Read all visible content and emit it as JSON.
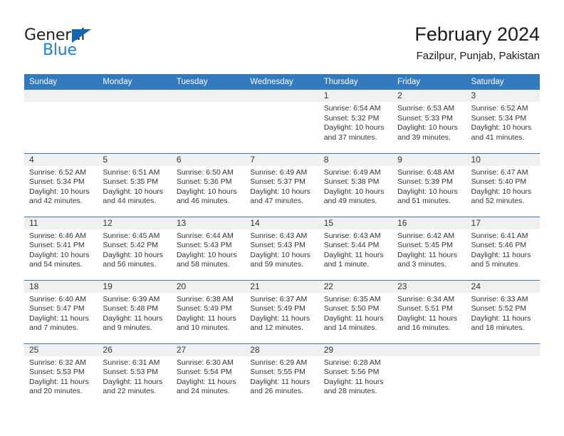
{
  "brand": {
    "logo_text_primary": "General",
    "logo_text_secondary": "Blue",
    "color_primary": "#231f20",
    "color_secondary": "#1b7fd4",
    "triangle_color": "#1565b0"
  },
  "header": {
    "title": "February 2024",
    "subtitle": "Fazilpur, Punjab, Pakistan"
  },
  "theme": {
    "header_row_bg": "#3379bd",
    "daynum_band_bg": "#f0f0f0",
    "row_divider": "#3379bd",
    "text": "#333333"
  },
  "weekdays": [
    "Sunday",
    "Monday",
    "Tuesday",
    "Wednesday",
    "Thursday",
    "Friday",
    "Saturday"
  ],
  "weeks": [
    [
      {
        "day": "",
        "sunrise": "",
        "sunset": "",
        "daylight": "",
        "daylight2": ""
      },
      {
        "day": "",
        "sunrise": "",
        "sunset": "",
        "daylight": "",
        "daylight2": ""
      },
      {
        "day": "",
        "sunrise": "",
        "sunset": "",
        "daylight": "",
        "daylight2": ""
      },
      {
        "day": "",
        "sunrise": "",
        "sunset": "",
        "daylight": "",
        "daylight2": ""
      },
      {
        "day": "1",
        "sunrise": "Sunrise: 6:54 AM",
        "sunset": "Sunset: 5:32 PM",
        "daylight": "Daylight: 10 hours",
        "daylight2": "and 37 minutes."
      },
      {
        "day": "2",
        "sunrise": "Sunrise: 6:53 AM",
        "sunset": "Sunset: 5:33 PM",
        "daylight": "Daylight: 10 hours",
        "daylight2": "and 39 minutes."
      },
      {
        "day": "3",
        "sunrise": "Sunrise: 6:52 AM",
        "sunset": "Sunset: 5:34 PM",
        "daylight": "Daylight: 10 hours",
        "daylight2": "and 41 minutes."
      }
    ],
    [
      {
        "day": "4",
        "sunrise": "Sunrise: 6:52 AM",
        "sunset": "Sunset: 5:34 PM",
        "daylight": "Daylight: 10 hours",
        "daylight2": "and 42 minutes."
      },
      {
        "day": "5",
        "sunrise": "Sunrise: 6:51 AM",
        "sunset": "Sunset: 5:35 PM",
        "daylight": "Daylight: 10 hours",
        "daylight2": "and 44 minutes."
      },
      {
        "day": "6",
        "sunrise": "Sunrise: 6:50 AM",
        "sunset": "Sunset: 5:36 PM",
        "daylight": "Daylight: 10 hours",
        "daylight2": "and 46 minutes."
      },
      {
        "day": "7",
        "sunrise": "Sunrise: 6:49 AM",
        "sunset": "Sunset: 5:37 PM",
        "daylight": "Daylight: 10 hours",
        "daylight2": "and 47 minutes."
      },
      {
        "day": "8",
        "sunrise": "Sunrise: 6:49 AM",
        "sunset": "Sunset: 5:38 PM",
        "daylight": "Daylight: 10 hours",
        "daylight2": "and 49 minutes."
      },
      {
        "day": "9",
        "sunrise": "Sunrise: 6:48 AM",
        "sunset": "Sunset: 5:39 PM",
        "daylight": "Daylight: 10 hours",
        "daylight2": "and 51 minutes."
      },
      {
        "day": "10",
        "sunrise": "Sunrise: 6:47 AM",
        "sunset": "Sunset: 5:40 PM",
        "daylight": "Daylight: 10 hours",
        "daylight2": "and 52 minutes."
      }
    ],
    [
      {
        "day": "11",
        "sunrise": "Sunrise: 6:46 AM",
        "sunset": "Sunset: 5:41 PM",
        "daylight": "Daylight: 10 hours",
        "daylight2": "and 54 minutes."
      },
      {
        "day": "12",
        "sunrise": "Sunrise: 6:45 AM",
        "sunset": "Sunset: 5:42 PM",
        "daylight": "Daylight: 10 hours",
        "daylight2": "and 56 minutes."
      },
      {
        "day": "13",
        "sunrise": "Sunrise: 6:44 AM",
        "sunset": "Sunset: 5:43 PM",
        "daylight": "Daylight: 10 hours",
        "daylight2": "and 58 minutes."
      },
      {
        "day": "14",
        "sunrise": "Sunrise: 6:43 AM",
        "sunset": "Sunset: 5:43 PM",
        "daylight": "Daylight: 10 hours",
        "daylight2": "and 59 minutes."
      },
      {
        "day": "15",
        "sunrise": "Sunrise: 6:43 AM",
        "sunset": "Sunset: 5:44 PM",
        "daylight": "Daylight: 11 hours",
        "daylight2": "and 1 minute."
      },
      {
        "day": "16",
        "sunrise": "Sunrise: 6:42 AM",
        "sunset": "Sunset: 5:45 PM",
        "daylight": "Daylight: 11 hours",
        "daylight2": "and 3 minutes."
      },
      {
        "day": "17",
        "sunrise": "Sunrise: 6:41 AM",
        "sunset": "Sunset: 5:46 PM",
        "daylight": "Daylight: 11 hours",
        "daylight2": "and 5 minutes."
      }
    ],
    [
      {
        "day": "18",
        "sunrise": "Sunrise: 6:40 AM",
        "sunset": "Sunset: 5:47 PM",
        "daylight": "Daylight: 11 hours",
        "daylight2": "and 7 minutes."
      },
      {
        "day": "19",
        "sunrise": "Sunrise: 6:39 AM",
        "sunset": "Sunset: 5:48 PM",
        "daylight": "Daylight: 11 hours",
        "daylight2": "and 9 minutes."
      },
      {
        "day": "20",
        "sunrise": "Sunrise: 6:38 AM",
        "sunset": "Sunset: 5:49 PM",
        "daylight": "Daylight: 11 hours",
        "daylight2": "and 10 minutes."
      },
      {
        "day": "21",
        "sunrise": "Sunrise: 6:37 AM",
        "sunset": "Sunset: 5:49 PM",
        "daylight": "Daylight: 11 hours",
        "daylight2": "and 12 minutes."
      },
      {
        "day": "22",
        "sunrise": "Sunrise: 6:35 AM",
        "sunset": "Sunset: 5:50 PM",
        "daylight": "Daylight: 11 hours",
        "daylight2": "and 14 minutes."
      },
      {
        "day": "23",
        "sunrise": "Sunrise: 6:34 AM",
        "sunset": "Sunset: 5:51 PM",
        "daylight": "Daylight: 11 hours",
        "daylight2": "and 16 minutes."
      },
      {
        "day": "24",
        "sunrise": "Sunrise: 6:33 AM",
        "sunset": "Sunset: 5:52 PM",
        "daylight": "Daylight: 11 hours",
        "daylight2": "and 18 minutes."
      }
    ],
    [
      {
        "day": "25",
        "sunrise": "Sunrise: 6:32 AM",
        "sunset": "Sunset: 5:53 PM",
        "daylight": "Daylight: 11 hours",
        "daylight2": "and 20 minutes."
      },
      {
        "day": "26",
        "sunrise": "Sunrise: 6:31 AM",
        "sunset": "Sunset: 5:53 PM",
        "daylight": "Daylight: 11 hours",
        "daylight2": "and 22 minutes."
      },
      {
        "day": "27",
        "sunrise": "Sunrise: 6:30 AM",
        "sunset": "Sunset: 5:54 PM",
        "daylight": "Daylight: 11 hours",
        "daylight2": "and 24 minutes."
      },
      {
        "day": "28",
        "sunrise": "Sunrise: 6:29 AM",
        "sunset": "Sunset: 5:55 PM",
        "daylight": "Daylight: 11 hours",
        "daylight2": "and 26 minutes."
      },
      {
        "day": "29",
        "sunrise": "Sunrise: 6:28 AM",
        "sunset": "Sunset: 5:56 PM",
        "daylight": "Daylight: 11 hours",
        "daylight2": "and 28 minutes."
      },
      {
        "day": "",
        "sunrise": "",
        "sunset": "",
        "daylight": "",
        "daylight2": ""
      },
      {
        "day": "",
        "sunrise": "",
        "sunset": "",
        "daylight": "",
        "daylight2": ""
      }
    ]
  ]
}
